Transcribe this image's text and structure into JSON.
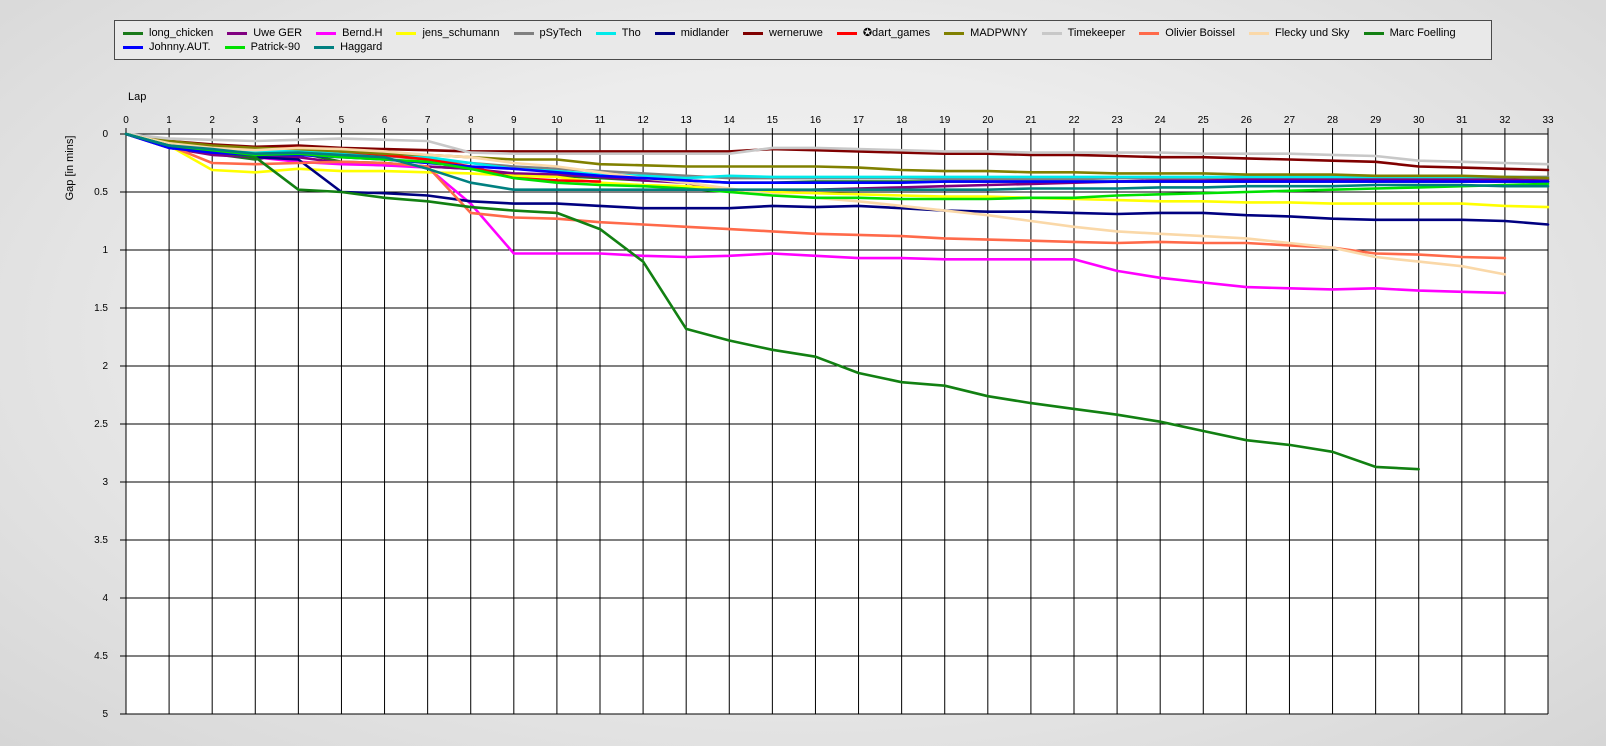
{
  "chart_data": {
    "type": "line",
    "xlabel": "Lap",
    "ylabel": "Gap [in mins]",
    "x_ticks": [
      0,
      1,
      2,
      3,
      4,
      5,
      6,
      7,
      8,
      9,
      10,
      11,
      12,
      13,
      14,
      15,
      16,
      17,
      18,
      19,
      20,
      21,
      22,
      23,
      24,
      25,
      26,
      27,
      28,
      29,
      30,
      31,
      32,
      33
    ],
    "y_ticks": [
      "0",
      "0.5",
      "1",
      "1.5",
      "2",
      "2.5",
      "3",
      "3.5",
      "4",
      "4.5",
      "5"
    ],
    "xlim": [
      0,
      33
    ],
    "ylim": [
      0,
      5
    ],
    "y_inverted": true,
    "grid": true,
    "legend_position": "top",
    "series": [
      {
        "name": "long_chicken",
        "color": "#1a7a1a",
        "values": [
          0,
          0.1,
          0.17,
          0.22,
          0.16,
          0.24,
          0.25,
          0.28,
          0.3,
          0.35,
          0.36,
          0.38,
          0.4,
          0.4,
          0.42,
          0.42,
          0.41,
          0.41,
          0.41,
          0.41,
          0.41,
          0.41,
          0.41,
          0.41,
          0.41,
          0.41,
          0.41,
          0.41,
          0.41,
          0.41,
          0.41,
          0.41,
          0.41,
          0.41
        ]
      },
      {
        "name": "Uwe GER",
        "color": "#800080",
        "values": [
          0,
          0.12,
          0.18,
          0.2,
          0.2,
          0.25,
          0.27,
          0.28,
          0.3,
          0.34,
          0.35,
          0.37,
          0.4,
          0.42,
          0.5,
          0.49,
          0.48,
          0.47,
          0.46,
          0.45,
          0.44,
          0.43,
          0.42,
          0.41,
          0.4,
          0.4,
          0.39,
          0.39,
          0.39,
          0.39,
          0.39,
          0.39,
          0.39,
          0.39
        ]
      },
      {
        "name": "Bernd.H",
        "color": "#ff00ff",
        "values": [
          0,
          0.08,
          0.15,
          0.2,
          0.24,
          0.26,
          0.27,
          0.29,
          0.6,
          1.03,
          1.03,
          1.03,
          1.05,
          1.06,
          1.05,
          1.03,
          1.05,
          1.07,
          1.07,
          1.08,
          1.08,
          1.08,
          1.08,
          1.18,
          1.24,
          1.28,
          1.32,
          1.33,
          1.34,
          1.33,
          1.35,
          1.36,
          1.37
        ]
      },
      {
        "name": "jens_schumann",
        "color": "#ffff00",
        "values": [
          0,
          0.1,
          0.31,
          0.33,
          0.3,
          0.32,
          0.32,
          0.33,
          0.34,
          0.36,
          0.37,
          0.42,
          0.44,
          0.45,
          0.48,
          0.5,
          0.51,
          0.52,
          0.53,
          0.54,
          0.54,
          0.55,
          0.56,
          0.57,
          0.58,
          0.58,
          0.59,
          0.59,
          0.6,
          0.6,
          0.6,
          0.6,
          0.62,
          0.63
        ]
      },
      {
        "name": "pSyTech",
        "color": "#808080",
        "values": [
          0,
          0.1,
          0.14,
          0.18,
          0.17,
          0.18,
          0.19,
          0.22,
          0.25,
          0.28,
          0.3,
          0.32,
          0.34,
          0.36,
          0.38,
          0.38,
          0.38,
          0.38,
          0.38,
          0.39,
          0.39,
          0.39,
          0.39,
          0.38,
          0.38,
          0.38,
          0.37,
          0.37,
          0.37,
          0.37,
          0.37,
          0.37,
          0.37,
          0.37
        ]
      },
      {
        "name": "Tho",
        "color": "#00eaea",
        "values": [
          0,
          0.1,
          0.13,
          0.16,
          0.14,
          0.16,
          0.18,
          0.2,
          0.25,
          0.3,
          0.32,
          0.35,
          0.36,
          0.38,
          0.36,
          0.37,
          0.37,
          0.37,
          0.37,
          0.37,
          0.37,
          0.37,
          0.37,
          0.37,
          0.37,
          0.37,
          0.37,
          0.37,
          0.37,
          0.37,
          0.37,
          0.37,
          0.37,
          0.38
        ]
      },
      {
        "name": "midlander",
        "color": "#000080",
        "values": [
          0,
          0.1,
          0.15,
          0.2,
          0.22,
          0.5,
          0.51,
          0.53,
          0.58,
          0.6,
          0.6,
          0.62,
          0.64,
          0.64,
          0.64,
          0.62,
          0.63,
          0.62,
          0.64,
          0.66,
          0.67,
          0.67,
          0.68,
          0.69,
          0.68,
          0.68,
          0.7,
          0.71,
          0.73,
          0.74,
          0.74,
          0.74,
          0.75,
          0.78
        ]
      },
      {
        "name": "werneruwe",
        "color": "#800000",
        "values": [
          0,
          0.06,
          0.09,
          0.11,
          0.1,
          0.12,
          0.13,
          0.14,
          0.15,
          0.15,
          0.15,
          0.15,
          0.15,
          0.15,
          0.15,
          0.13,
          0.14,
          0.15,
          0.16,
          0.17,
          0.17,
          0.18,
          0.18,
          0.19,
          0.2,
          0.2,
          0.21,
          0.22,
          0.23,
          0.24,
          0.28,
          0.29,
          0.3,
          0.31
        ]
      },
      {
        "name": "✪dart_games",
        "color": "#ff0000",
        "values": [
          0,
          0.08,
          0.12,
          0.13,
          0.12,
          0.15,
          0.18,
          0.22,
          0.28,
          0.38,
          0.4,
          0.41
        ]
      },
      {
        "name": "MADPWNY",
        "color": "#808000",
        "values": [
          0,
          0.06,
          0.1,
          0.12,
          0.13,
          0.15,
          0.17,
          0.18,
          0.2,
          0.22,
          0.22,
          0.26,
          0.27,
          0.28,
          0.28,
          0.28,
          0.28,
          0.29,
          0.31,
          0.32,
          0.32,
          0.33,
          0.33,
          0.34,
          0.34,
          0.34,
          0.35,
          0.35,
          0.35,
          0.36,
          0.36,
          0.36,
          0.37,
          0.38
        ]
      },
      {
        "name": "Timekeeper",
        "color": "#c8c8c8",
        "values": [
          0,
          0.04,
          0.05,
          0.06,
          0.05,
          0.04,
          0.05,
          0.06,
          0.16,
          0.17,
          0.17,
          0.17,
          0.17,
          0.17,
          0.17,
          0.12,
          0.12,
          0.13,
          0.14,
          0.15,
          0.15,
          0.16,
          0.16,
          0.16,
          0.16,
          0.17,
          0.17,
          0.17,
          0.18,
          0.19,
          0.23,
          0.24,
          0.25,
          0.26
        ]
      },
      {
        "name": "Olivier Boissel",
        "color": "#ff6a4a",
        "values": [
          0,
          0.1,
          0.25,
          0.26,
          0.25,
          0.24,
          0.25,
          0.28,
          0.68,
          0.72,
          0.73,
          0.76,
          0.78,
          0.8,
          0.82,
          0.84,
          0.86,
          0.87,
          0.88,
          0.9,
          0.91,
          0.92,
          0.93,
          0.94,
          0.93,
          0.94,
          0.94,
          0.96,
          0.98,
          1.03,
          1.04,
          1.06,
          1.07
        ]
      },
      {
        "name": "Flecky und Sky",
        "color": "#fad8a8",
        "values": [
          0,
          0.08,
          0.12,
          0.14,
          0.12,
          0.13,
          0.15,
          0.18,
          0.2,
          0.25,
          0.28,
          0.33,
          0.38,
          0.42,
          0.47,
          0.52,
          0.55,
          0.58,
          0.62,
          0.66,
          0.7,
          0.75,
          0.8,
          0.84,
          0.86,
          0.88,
          0.9,
          0.94,
          0.98,
          1.06,
          1.1,
          1.14,
          1.21
        ]
      },
      {
        "name": "Marc Foelling",
        "color": "#128012",
        "values": [
          0,
          0.1,
          0.15,
          0.2,
          0.48,
          0.5,
          0.55,
          0.58,
          0.63,
          0.66,
          0.68,
          0.82,
          1.1,
          1.68,
          1.78,
          1.86,
          1.92,
          2.06,
          2.14,
          2.17,
          2.26,
          2.32,
          2.37,
          2.42,
          2.48,
          2.56,
          2.64,
          2.68,
          2.74,
          2.87,
          2.89
        ]
      },
      {
        "name": "Johnny.AUT.",
        "color": "#0000ff",
        "values": [
          0,
          0.12,
          0.16,
          0.18,
          0.18,
          0.2,
          0.22,
          0.25,
          0.28,
          0.3,
          0.33,
          0.36,
          0.38,
          0.4,
          0.42,
          0.42,
          0.42,
          0.42,
          0.42,
          0.41,
          0.41,
          0.41,
          0.41,
          0.41,
          0.41,
          0.41,
          0.41,
          0.41,
          0.41,
          0.41,
          0.41,
          0.41,
          0.41,
          0.41
        ]
      },
      {
        "name": "Patrick-90",
        "color": "#00e000",
        "values": [
          0,
          0.1,
          0.14,
          0.18,
          0.17,
          0.2,
          0.22,
          0.24,
          0.3,
          0.38,
          0.42,
          0.44,
          0.45,
          0.47,
          0.5,
          0.53,
          0.55,
          0.55,
          0.56,
          0.56,
          0.56,
          0.55,
          0.55,
          0.53,
          0.52,
          0.51,
          0.5,
          0.49,
          0.48,
          0.47,
          0.46,
          0.45,
          0.44,
          0.43
        ]
      },
      {
        "name": "Haggard",
        "color": "#008080",
        "values": [
          0,
          0.1,
          0.13,
          0.17,
          0.16,
          0.18,
          0.2,
          0.3,
          0.42,
          0.48,
          0.48,
          0.48,
          0.48,
          0.48,
          0.48,
          0.48,
          0.48,
          0.48,
          0.48,
          0.48,
          0.48,
          0.47,
          0.47,
          0.47,
          0.46,
          0.46,
          0.45,
          0.45,
          0.45,
          0.44,
          0.44,
          0.44,
          0.45,
          0.45
        ]
      }
    ]
  }
}
